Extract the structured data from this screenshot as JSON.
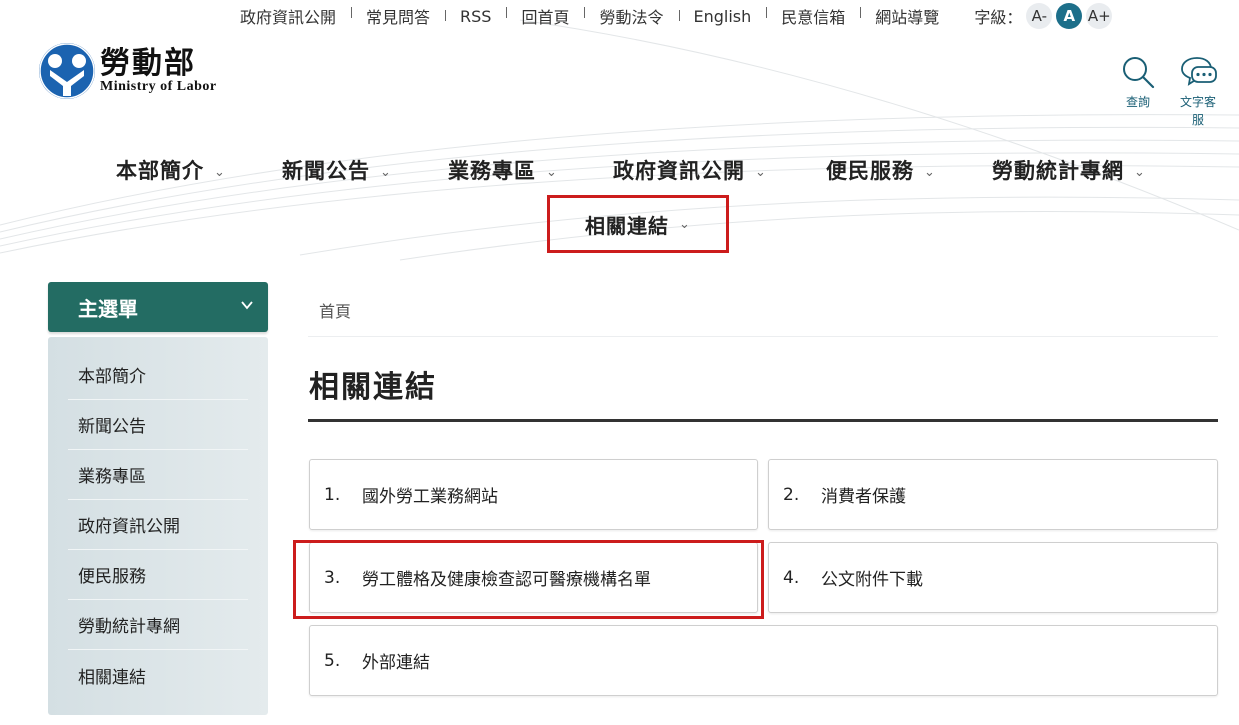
{
  "top_links": [
    "政府資訊公開",
    "常見問答",
    "RSS",
    "回首頁",
    "勞動法令",
    "English",
    "民意信箱",
    "網站導覽"
  ],
  "font_size": {
    "label": "字級：",
    "options": [
      "A-",
      "A",
      "A+"
    ],
    "active": "A"
  },
  "logo": {
    "name_cn": "勞動部",
    "name_en": "Ministry  of  Labor"
  },
  "tools": {
    "search_label": "查詢",
    "chat_label_1": "文字客",
    "chat_label_2": "服"
  },
  "main_nav": [
    "本部簡介",
    "新聞公告",
    "業務專區",
    "政府資訊公開",
    "便民服務",
    "勞動統計專網",
    "相關連結"
  ],
  "sidebar": {
    "title": "主選單",
    "items": [
      "本部簡介",
      "新聞公告",
      "業務專區",
      "政府資訊公開",
      "便民服務",
      "勞動統計專網",
      "相關連結"
    ]
  },
  "breadcrumb": "首頁",
  "page_title": "相關連結",
  "links": [
    {
      "num": "1.",
      "label": "國外勞工業務網站"
    },
    {
      "num": "2.",
      "label": "消費者保護"
    },
    {
      "num": "3.",
      "label": "勞工體格及健康檢查認可醫療機構名單"
    },
    {
      "num": "4.",
      "label": "公文附件下載"
    },
    {
      "num": "5.",
      "label": "外部連結"
    }
  ],
  "colors": {
    "sidebar_header": "#236c63",
    "highlight": "#cc1c1c",
    "accent": "#1d6f8a"
  }
}
